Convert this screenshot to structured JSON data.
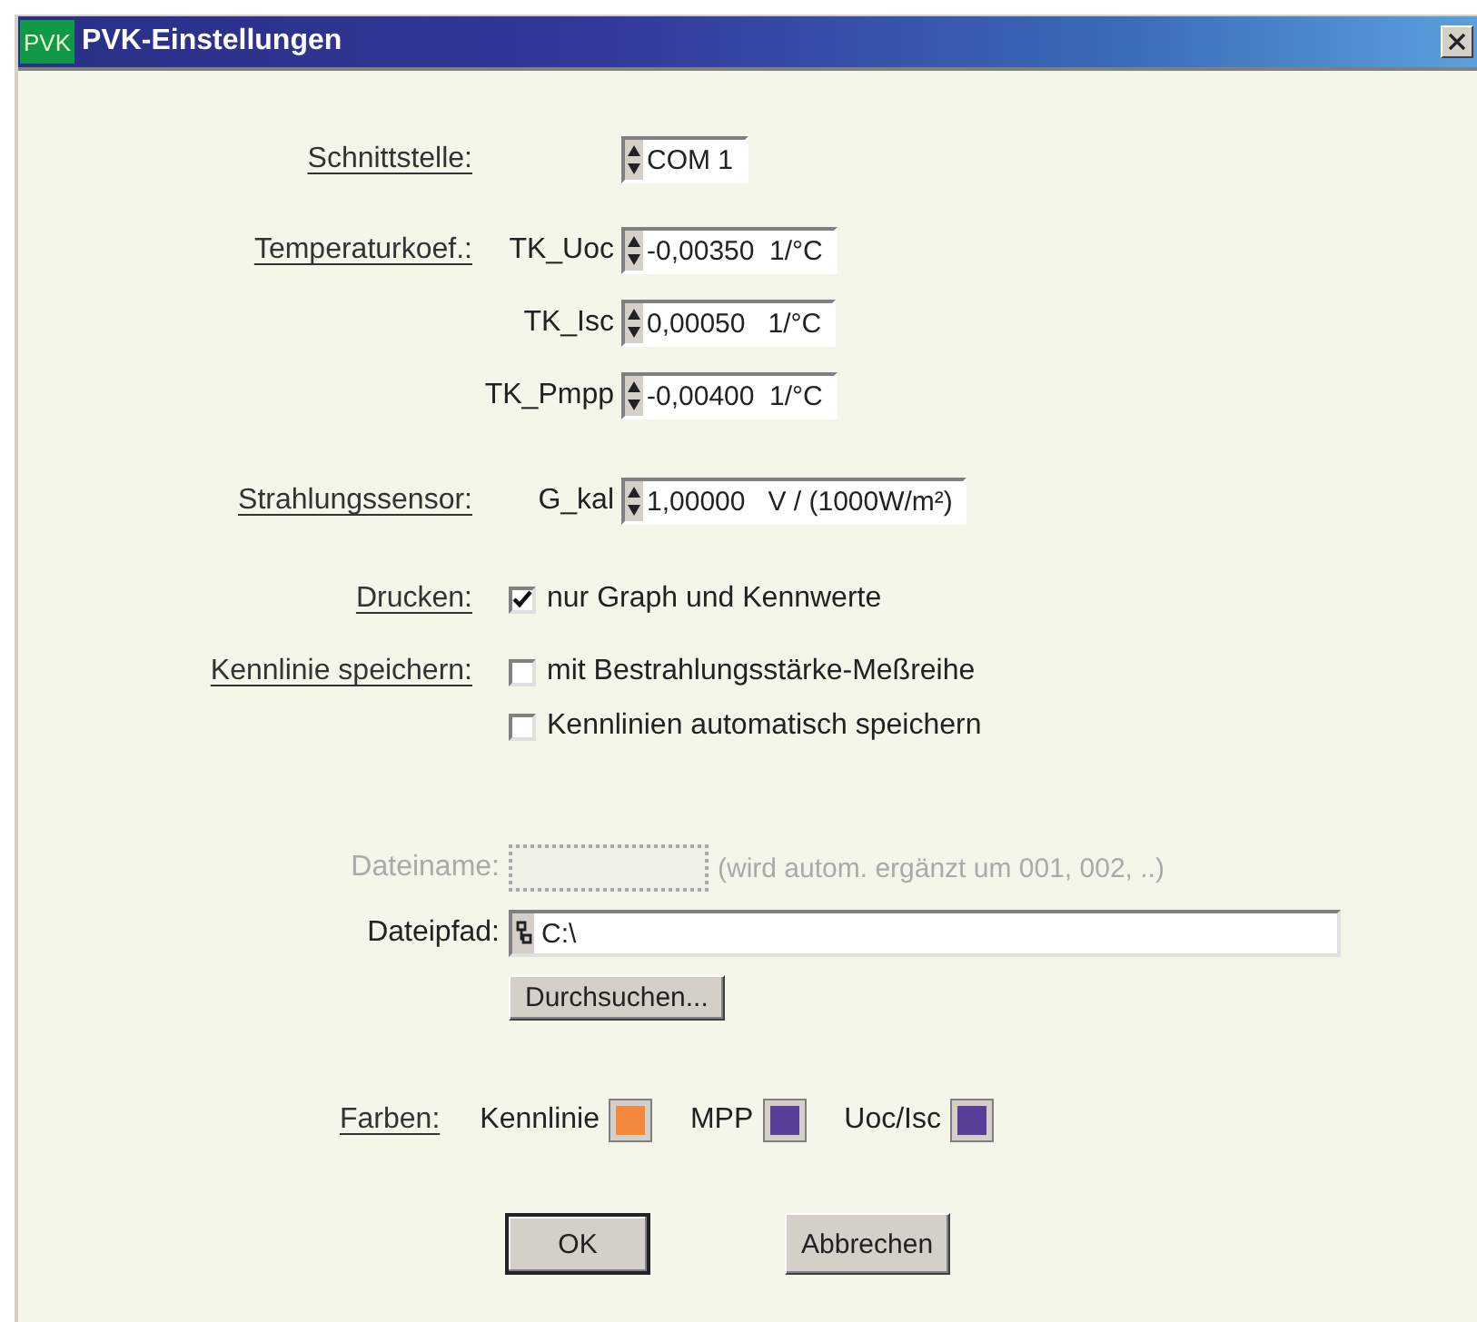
{
  "window": {
    "icon": "PVK",
    "title": "PVK-Einstellungen"
  },
  "interface": {
    "label": "Schnittstelle:",
    "value": "COM 1"
  },
  "temperature": {
    "label": "Temperaturkoef.:",
    "items": [
      {
        "name": "TK_Uoc",
        "value": "-0,00350  1/°C"
      },
      {
        "name": "TK_Isc",
        "value": "0,00050   1/°C"
      },
      {
        "name": "TK_Pmpp",
        "value": "-0,00400  1/°C"
      }
    ]
  },
  "sensor": {
    "label": "Strahlungssensor:",
    "name": "G_kal",
    "value": "1,00000   V / (1000W/m²)"
  },
  "print": {
    "label": "Drucken:",
    "options": [
      {
        "label": "nur Graph und Kennwerte",
        "checked": true
      }
    ]
  },
  "save": {
    "label": "Kennlinie speichern:",
    "options": [
      {
        "label": "mit Bestrahlungsstärke-Meßreihe",
        "checked": false
      },
      {
        "label": "Kennlinien automatisch speichern",
        "checked": false
      }
    ]
  },
  "filename": {
    "label": "Dateiname:",
    "disabled": true,
    "hint": "(wird autom. ergänzt um 001, 002, ..)"
  },
  "path": {
    "label": "Dateipfad:",
    "value": "C:\\"
  },
  "browse_button": "Durchsuchen...",
  "colors": {
    "label": "Farben:",
    "items": [
      {
        "label": "Kennlinie",
        "color": "#f5883f"
      },
      {
        "label": "MPP",
        "color": "#5a3f9a"
      },
      {
        "label": "Uoc/Isc",
        "color": "#5a3f9a"
      }
    ]
  },
  "buttons": [
    {
      "label": "OK",
      "default": true
    },
    {
      "label": "Abbrechen",
      "default": false
    }
  ]
}
